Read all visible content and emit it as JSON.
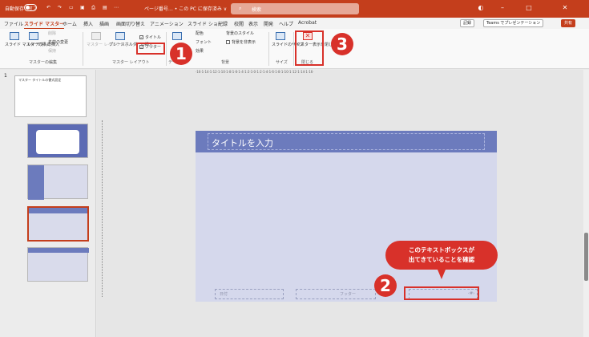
{
  "titlebar": {
    "autosave": "自動保存",
    "autosave_state": "オフ",
    "doc_title": "ページ番号… • この PC に保存済み ∨",
    "search_placeholder": "検索"
  },
  "tabs": [
    "ファイル",
    "スライド マスター",
    "ホーム",
    "挿入",
    "描画",
    "画面切り替え",
    "アニメーション",
    "スライド ショー",
    "記録",
    "校閲",
    "表示",
    "開発",
    "ヘルプ",
    "Acrobat"
  ],
  "tab_actions": {
    "record": "記録",
    "teams": "Teams でプレゼンテーション",
    "share": "共有"
  },
  "ribbon": {
    "insert_master": "スライド マスターの挿入",
    "insert_layout": "レイアウトの挿入",
    "delete": "削除",
    "rename": "名前の変更",
    "preserve": "保持",
    "group_edit_master": "マスターの編集",
    "master_layout": "マスター レイアウト",
    "insert_placeholder": "プレースホルダーの挿入",
    "title_check": "タイトル",
    "footer_check": "フッター",
    "group_master_layout": "マスター レイアウト",
    "group_edit_theme": "テーマ",
    "colors": "配色",
    "fonts": "フォント",
    "effects": "効果",
    "bg_styles": "背景のスタイル",
    "hide_bg": "背景を非表示",
    "group_background": "背景",
    "slide_size": "スライドのサイズ",
    "group_size": "サイズ",
    "close_master": "マスター表示を閉じる",
    "group_close": "閉じる"
  },
  "badges": [
    "1",
    "2",
    "3"
  ],
  "thumbnails": {
    "number": "1",
    "master_title": "マスター タイトルの書式設定"
  },
  "slide": {
    "title": "タイトルを入力",
    "date": "日付",
    "footer": "フッター",
    "page_num": "‹#›"
  },
  "callout": {
    "line1": "このテキストボックスが",
    "line2": "出てきていることを確認"
  },
  "ruler_h": "·16·1·14·1·12·1·10·1·8·1·6·1·4·1·2·1·0·1·2·1·4·1·6·1·8·1·10·1·12·1·14·1·16·",
  "colors": {
    "accent": "#c43e1c",
    "highlight": "#d8312a",
    "slide_title": "#6c7bbd",
    "slide_bg": "#d5d8ec"
  }
}
